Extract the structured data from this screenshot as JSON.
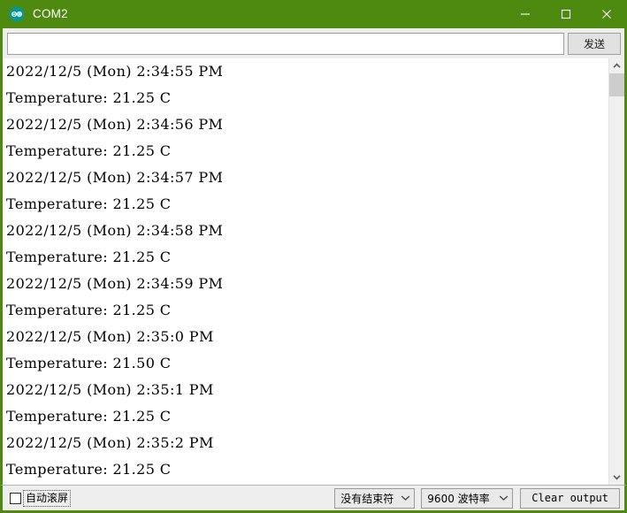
{
  "window": {
    "title": "COM2",
    "icon": "arduino-logo-icon",
    "titlebar_color": "#4f8a10",
    "controls": {
      "minimize": "minimize-icon",
      "maximize": "maximize-icon",
      "close": "close-icon"
    }
  },
  "send_row": {
    "input_value": "",
    "input_placeholder": "",
    "send_label": "发送"
  },
  "console": {
    "lines": [
      "2022/12/5 (Mon) 2:34:55 PM",
      "Temperature: 21.25 C",
      "2022/12/5 (Mon) 2:34:56 PM",
      "Temperature: 21.25 C",
      "2022/12/5 (Mon) 2:34:57 PM",
      "Temperature: 21.25 C",
      "2022/12/5 (Mon) 2:34:58 PM",
      "Temperature: 21.25 C",
      "2022/12/5 (Mon) 2:34:59 PM",
      "Temperature: 21.25 C",
      "2022/12/5 (Mon) 2:35:0 PM",
      "Temperature: 21.50 C",
      "2022/12/5 (Mon) 2:35:1 PM",
      "Temperature: 21.25 C",
      "2022/12/5 (Mon) 2:35:2 PM",
      "Temperature: 21.25 C"
    ]
  },
  "scrollbar": {
    "up_icon": "chevron-up-icon",
    "down_icon": "chevron-down-icon"
  },
  "status_bar": {
    "autoscroll_label": "自动滚屏",
    "autoscroll_checked": false,
    "line_ending": {
      "selected": "没有结束符",
      "chevron": "chevron-down-icon"
    },
    "baud_rate": {
      "selected": "9600 波特率",
      "chevron": "chevron-down-icon"
    },
    "clear_label": "Clear output"
  }
}
